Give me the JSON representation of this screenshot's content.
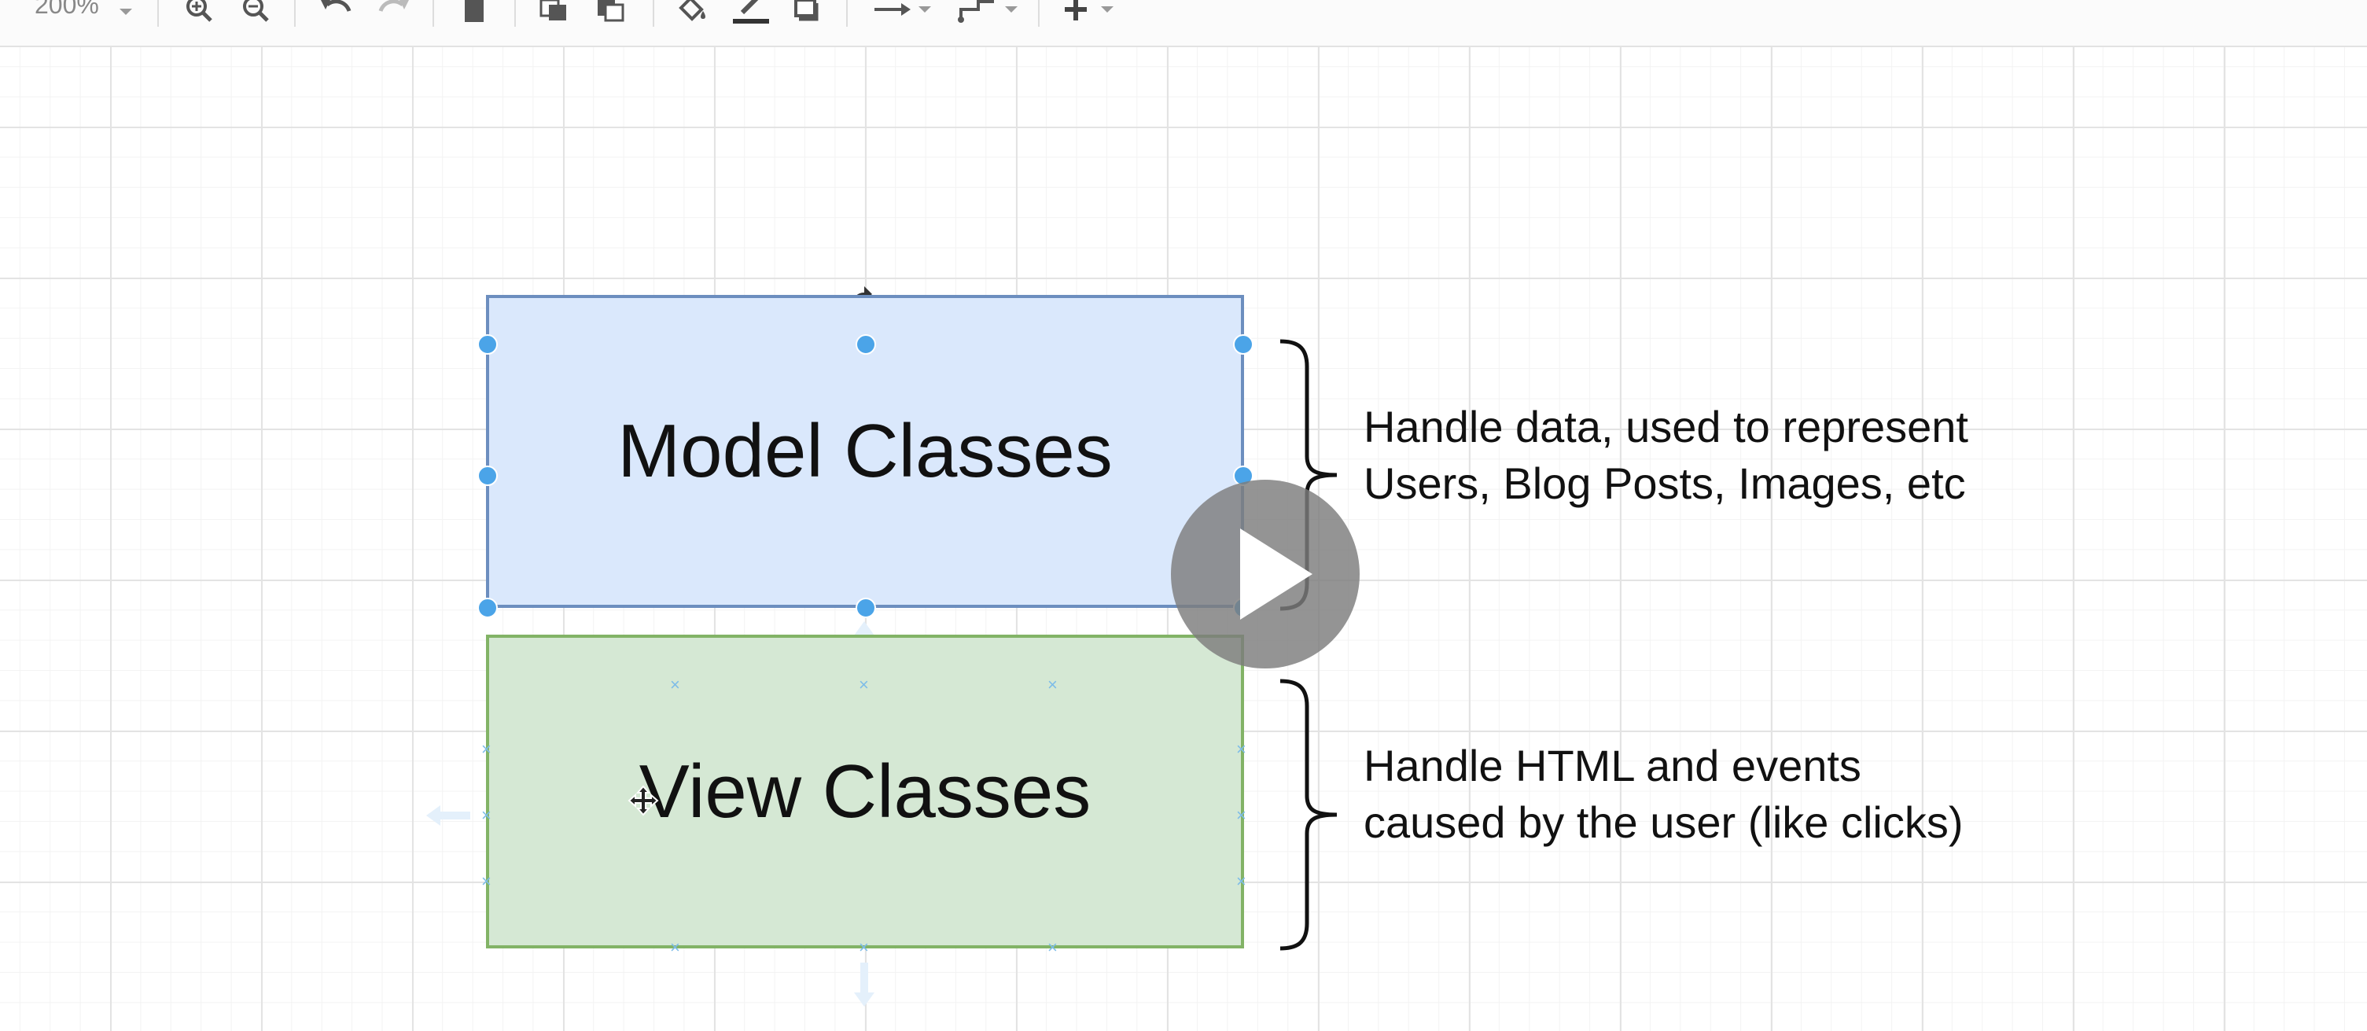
{
  "toolbar": {
    "zoom_value": "200%",
    "icons": [
      "zoom-in-icon",
      "zoom-out-icon",
      "undo-icon",
      "redo-icon",
      "delete-icon",
      "to-front-icon",
      "to-back-icon",
      "fill-color-icon",
      "line-color-icon",
      "shadow-icon",
      "connection-icon",
      "waypoint-icon",
      "insert-icon"
    ]
  },
  "diagram": {
    "model_box_label": "Model Classes",
    "model_box_fill": "#dae8fc",
    "model_box_stroke": "#6c8ebf",
    "view_box_label": "View Classes",
    "view_box_fill": "#d5e8d4",
    "view_box_stroke": "#82b366",
    "model_note": {
      "line1": "Handle data, used to represent",
      "line2": "Users, Blog Posts, Images, etc"
    },
    "view_note": {
      "line1": "Handle HTML and events",
      "line2": "caused by the user (like clicks)"
    },
    "selection_color": "#4ba4e8"
  },
  "overlay": {
    "play_icon": "play-icon"
  }
}
